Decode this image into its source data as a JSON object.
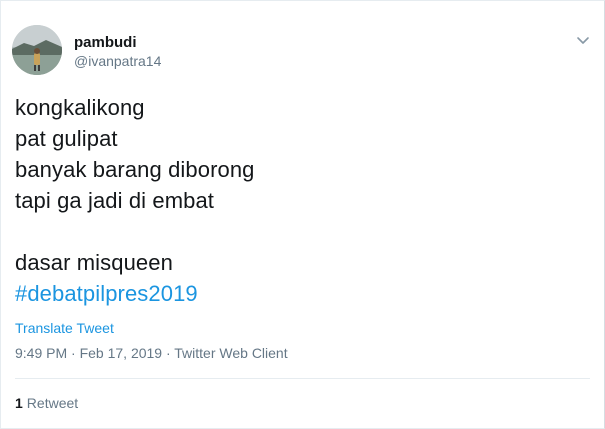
{
  "tweet": {
    "author_name": "pambudi",
    "author_handle": "@ivanpatra14",
    "lines": [
      "kongkalikong",
      "pat gulipat",
      "banyak barang diborong",
      "tapi ga jadi di embat",
      "",
      "dasar misqueen"
    ],
    "hashtag": "#debatpilpres2019",
    "translate_label": "Translate Tweet",
    "meta": "9:49 PM · Feb 17, 2019 · Twitter Web Client",
    "retweet_count": "1",
    "retweet_label": "Retweet"
  },
  "icons": {
    "menu": "chevron-down-icon"
  },
  "colors": {
    "link": "#1b95e0",
    "muted": "#657786",
    "text": "#14171a",
    "border": "#e6ecf0"
  }
}
